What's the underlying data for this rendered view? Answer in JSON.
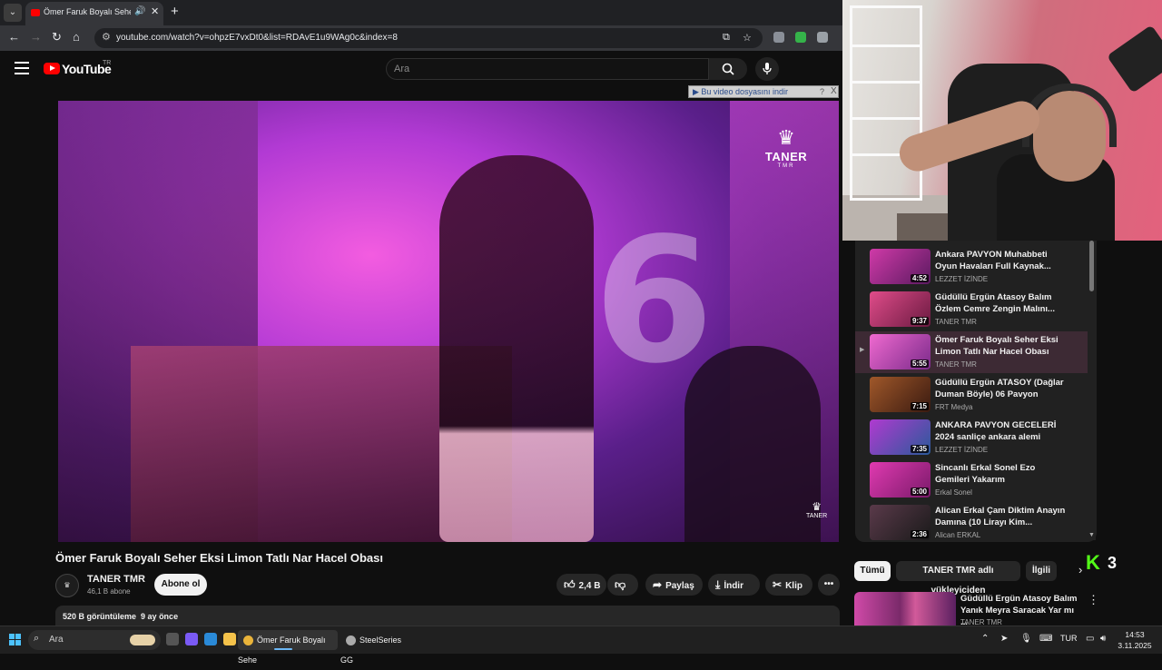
{
  "browser": {
    "tab_title": "Ömer Faruk Boyalı Seher Eksi",
    "url": "youtube.com/watch?v=ohpzE7vxDt0&list=RDAvE1u9WAg0c&index=8"
  },
  "header": {
    "logo_text": "YouTube",
    "country_code": "TR",
    "search_placeholder": "Ara"
  },
  "player": {
    "download_bar_text": "▶ Bu video dosyasını indir",
    "download_help": "?",
    "download_close": "X",
    "watermark_name": "TANER",
    "watermark_sub": "TMR",
    "overlay_number": "6"
  },
  "video": {
    "title": "Ömer Faruk Boyalı Seher Eksi Limon Tatlı Nar Hacel Obası",
    "channel_name": "TANER TMR",
    "subscribers": "46,1 B abone",
    "subscribe_label": "Abone ol",
    "likes": "2,4 B",
    "share_label": "Paylaş",
    "download_label": "İndir",
    "clip_label": "Klip",
    "views": "520 B görüntüleme",
    "age": "9 ay önce"
  },
  "playlist": {
    "items": [
      {
        "title": "Ankara PAVYON Muhabbeti Oyun Havaları Full Kaynak...",
        "channel": "LEZZET İZİNDE",
        "duration": "4:52",
        "active": false,
        "color": "#a22a8e"
      },
      {
        "title": "Güdüllü Ergün Atasoy Balım Özlem Cemre Zengin Malını...",
        "channel": "TANER TMR",
        "duration": "9:37",
        "active": false,
        "color": "#b03472"
      },
      {
        "title": "Ömer Faruk Boyalı Seher Eksi Limon Tatlı Nar Hacel Obası",
        "channel": "TANER TMR",
        "duration": "5:55",
        "active": true,
        "color": "#c44aa0"
      },
      {
        "title": "Güdüllü Ergün ATASOY (Dağlar Duman Böyle) 06 Pavyon",
        "channel": "FRT Medya",
        "duration": "7:15",
        "active": false,
        "color": "#8a4a30"
      },
      {
        "title": "ANKARA PAVYON GECELERİ 2024 sanliçe ankara alemi",
        "channel": "LEZZET İZİNDE",
        "duration": "7:35",
        "active": false,
        "color": "#8a2aa0"
      },
      {
        "title": "Sincanlı Erkal Sonel Ezo Gemileri Yakarım",
        "channel": "Erkal Sonel",
        "duration": "5:00",
        "active": false,
        "color": "#c23a9a"
      },
      {
        "title": "Alican Erkal Çam Diktim Anayın Damına (10 Lirayı Kim...",
        "channel": "Alican ERKAL",
        "duration": "2:36",
        "active": false,
        "color": "#4a2a3a"
      }
    ]
  },
  "chips": [
    "Tümü",
    "TANER TMR adlı yükleyiciden",
    "İlgili"
  ],
  "kick": {
    "count": "3"
  },
  "recommendation": {
    "title": "Güdüllü Ergün Atasoy Balım Yanık Meyra Saracak Yar mı ...",
    "channel": "TANER TMR"
  },
  "taskbar": {
    "search_text": "Ara",
    "task_chrome": "Ömer Faruk Boyalı Sehe",
    "task_steelseries": "SteelSeries GG",
    "language": "TUR",
    "time": "14:53",
    "date": "3.11.2025"
  },
  "colors": {
    "accent_red": "#ff0000",
    "background": "#0f0f0f",
    "kick_green": "#53fc18",
    "active_row": "#3d2a34"
  }
}
